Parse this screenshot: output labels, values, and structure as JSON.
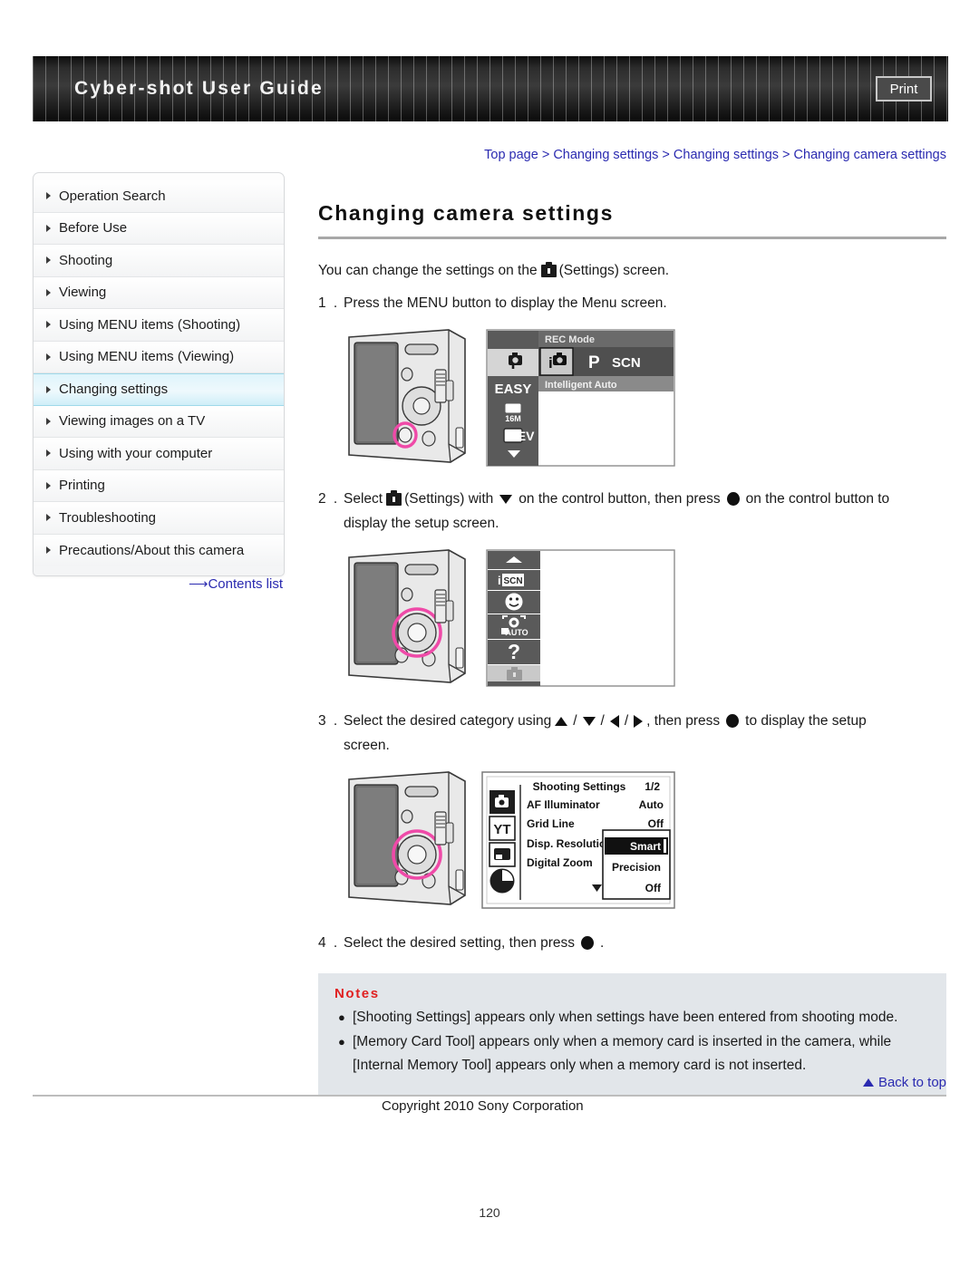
{
  "header": {
    "title": "Cyber-shot User Guide",
    "print_label": "Print"
  },
  "breadcrumb": {
    "text": "Top page > Changing settings > Changing settings > Changing camera settings",
    "color": "#2a2ab0"
  },
  "sidebar": {
    "items": [
      {
        "label": "Operation Search",
        "active": false
      },
      {
        "label": "Before Use",
        "active": false
      },
      {
        "label": "Shooting",
        "active": false
      },
      {
        "label": "Viewing",
        "active": false
      },
      {
        "label": "Using MENU items (Shooting)",
        "active": false
      },
      {
        "label": "Using MENU items (Viewing)",
        "active": false
      },
      {
        "label": "Changing settings",
        "active": true
      },
      {
        "label": "Viewing images on a TV",
        "active": false
      },
      {
        "label": "Using with your computer",
        "active": false
      },
      {
        "label": "Printing",
        "active": false
      },
      {
        "label": "Troubleshooting",
        "active": false
      },
      {
        "label": "Precautions/About this camera",
        "active": false
      }
    ],
    "contents_link": "Contents list",
    "active_color": "#dff4fb"
  },
  "main": {
    "title": "Changing camera settings",
    "intro_before": "You can change the settings on the",
    "intro_after": "(Settings) screen.",
    "steps": [
      {
        "num": "1 .",
        "text": "Press the MENU button to display the Menu screen."
      },
      {
        "num": "2 .",
        "part1": "Select",
        "part2": "(Settings) with",
        "part3": "on the control button, then press",
        "part4": "on the control button to",
        "part5": "display the setup screen."
      },
      {
        "num": "3 .",
        "part1": "Select the desired category using",
        "part2": ", then press",
        "part3": "to display the setup",
        "part4": "screen."
      },
      {
        "num": "4 .",
        "part1": "Select the desired setting, then press",
        "part2": "."
      }
    ]
  },
  "figure1": {
    "menu_header": "REC Mode",
    "mode_label": "Intelligent Auto",
    "left_items": [
      "i■",
      "EASY",
      "16M",
      "▭",
      "0EV"
    ],
    "mode_options": [
      "i",
      "P",
      "SCN"
    ],
    "easy_label": "EASY",
    "res_label": "16M",
    "ev_label": "0EV"
  },
  "figure2": {
    "menu_icons": [
      "scene-icon",
      "smile-icon",
      "face-auto-icon",
      "help-icon",
      "settings-icon"
    ],
    "scn_label": "SCN",
    "auto_label": "AUTO",
    "help_label": "?"
  },
  "figure3": {
    "screen_title": "Shooting Settings",
    "page_indicator": "1/2",
    "rows": [
      {
        "label": "AF Illuminator",
        "value": "Auto"
      },
      {
        "label": "Grid Line",
        "value": "Off"
      },
      {
        "label": "Disp. Resolution",
        "value": ""
      },
      {
        "label": "Digital Zoom",
        "value": ""
      }
    ],
    "dropdown_options": [
      "Smart",
      "Precision",
      "Off"
    ],
    "dropdown_selected": "Smart"
  },
  "notes": {
    "title": "Notes",
    "items": [
      "[Shooting Settings] appears only when settings have been entered from shooting mode.",
      "[Memory Card Tool] appears only when a memory card is inserted in the camera, while [Internal Memory Tool] appears only when a memory card is not inserted."
    ],
    "title_color": "#e02020",
    "background": "#e2e6ea"
  },
  "footer": {
    "back_to_top": "Back to top",
    "copyright": "Copyright 2010 Sony Corporation",
    "page_number": "120"
  }
}
